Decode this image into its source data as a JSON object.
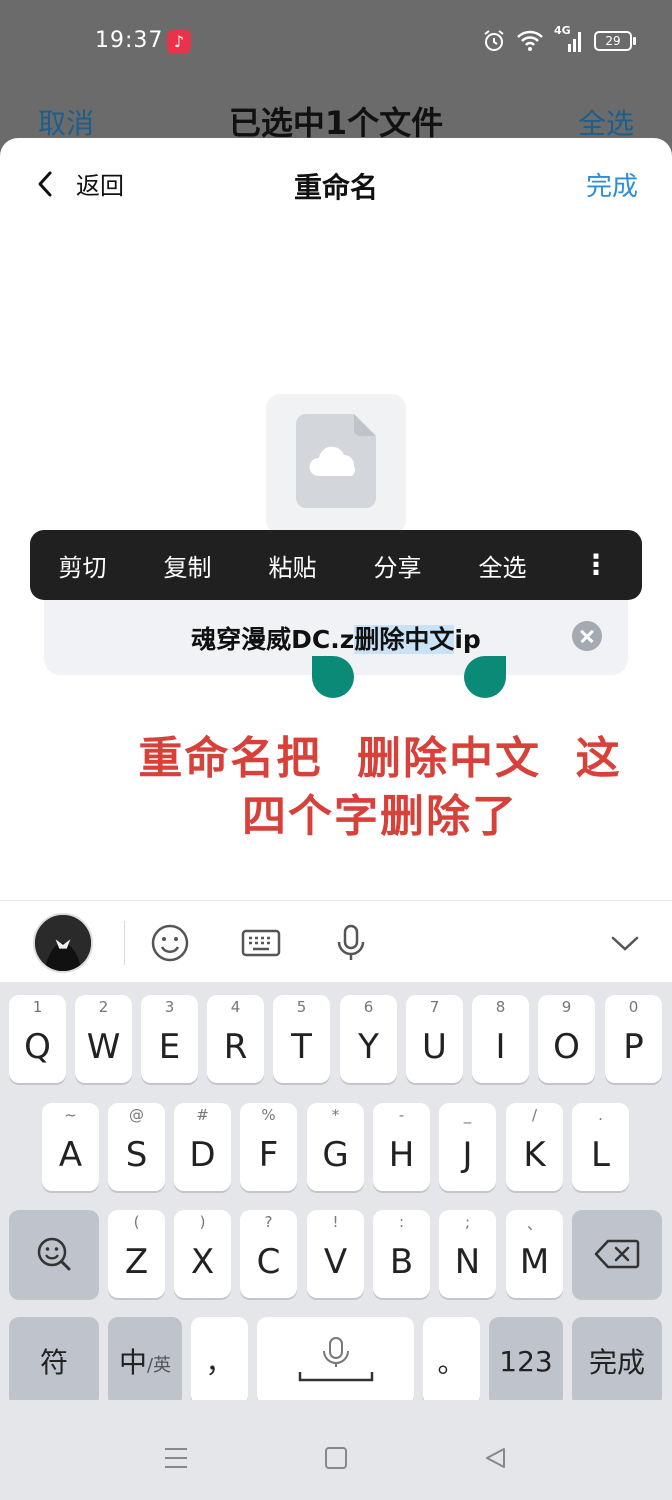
{
  "status": {
    "time": "19:37",
    "network": "4G",
    "battery": "29"
  },
  "background": {
    "cancel": "取消",
    "title": "已选中1个文件",
    "select_all": "全选"
  },
  "sheet": {
    "back": "返回",
    "title": "重命名",
    "done": "完成"
  },
  "context_menu": {
    "items": [
      "剪切",
      "复制",
      "粘贴",
      "分享",
      "全选"
    ],
    "more": "⋮"
  },
  "filename": {
    "before": "魂穿漫威DC.z",
    "selected": "删除中文",
    "after": "ip"
  },
  "annotation": {
    "line1": "重命名把  删除中文  这",
    "line2": "四个字删除了"
  },
  "keyboard": {
    "row1": [
      {
        "hint": "1",
        "key": "Q"
      },
      {
        "hint": "2",
        "key": "W"
      },
      {
        "hint": "3",
        "key": "E"
      },
      {
        "hint": "4",
        "key": "R"
      },
      {
        "hint": "5",
        "key": "T"
      },
      {
        "hint": "6",
        "key": "Y"
      },
      {
        "hint": "7",
        "key": "U"
      },
      {
        "hint": "8",
        "key": "I"
      },
      {
        "hint": "9",
        "key": "O"
      },
      {
        "hint": "0",
        "key": "P"
      }
    ],
    "row2": [
      {
        "hint": "~",
        "key": "A"
      },
      {
        "hint": "@",
        "key": "S"
      },
      {
        "hint": "#",
        "key": "D"
      },
      {
        "hint": "%",
        "key": "F"
      },
      {
        "hint": "*",
        "key": "G"
      },
      {
        "hint": "-",
        "key": "H"
      },
      {
        "hint": "_",
        "key": "J"
      },
      {
        "hint": "/",
        "key": "K"
      },
      {
        "hint": ".",
        "key": "L"
      }
    ],
    "row3": [
      {
        "hint": "(",
        "key": "Z"
      },
      {
        "hint": ")",
        "key": "X"
      },
      {
        "hint": "?",
        "key": "C"
      },
      {
        "hint": "!",
        "key": "V"
      },
      {
        "hint": ":",
        "key": "B"
      },
      {
        "hint": ";",
        "key": "N"
      },
      {
        "hint": "、",
        "key": "M"
      }
    ],
    "symbols": "符",
    "lang_main": "中",
    "lang_sub": "/英",
    "comma": "，",
    "period": "。",
    "numbers": "123",
    "done": "完成"
  }
}
